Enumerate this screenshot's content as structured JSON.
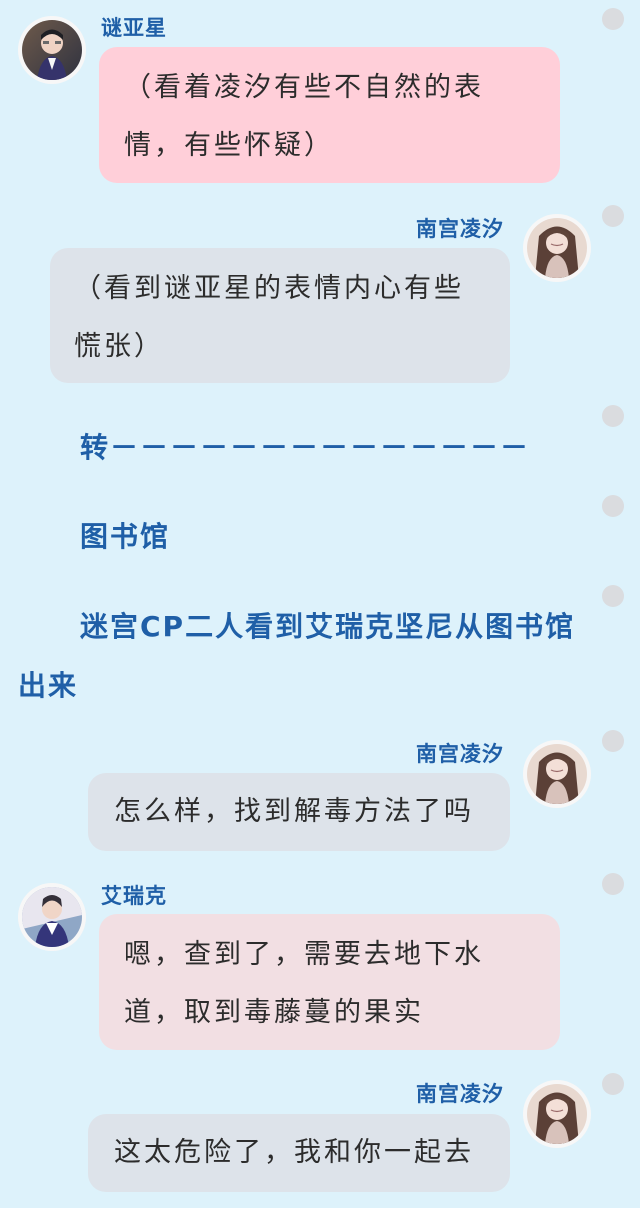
{
  "colors": {
    "background": "#ddf2fb",
    "name_text": "#1f5fa7",
    "narrative_text": "#1f5fa7",
    "pink_bubble": "#ffcfd9",
    "gray_bubble": "#dde3ea",
    "rose_bubble": "#f2dfe3"
  },
  "messages": [
    {
      "speaker": "谜亚星",
      "text": "（看着凌汐有些不自然的表\n情，有些怀疑）"
    },
    {
      "speaker": "南宫凌汐",
      "text": "（看到谜亚星的表情内心有些\n慌张）"
    },
    {
      "speaker": "南宫凌汐",
      "text": "怎么样，找到解毒方法了吗"
    },
    {
      "speaker": "艾瑞克",
      "text": "嗯，查到了，需要去地下水\n道，取到毒藤蔓的果实"
    },
    {
      "speaker": "南宫凌汐",
      "text": "这太危险了，我和你一起去"
    }
  ],
  "narration": {
    "transition": "转－－－－－－－－－－－－－－",
    "location": "图书馆",
    "action_line1": "迷宫CP二人看到艾瑞克坚尼从图书馆",
    "action_line2": "出来"
  },
  "icons": {
    "avatar_male_1": "portrait-avatar-icon",
    "avatar_female": "portrait-avatar-icon",
    "avatar_male_2": "portrait-avatar-icon",
    "rail_dot": "scroll-marker-dot-icon"
  }
}
